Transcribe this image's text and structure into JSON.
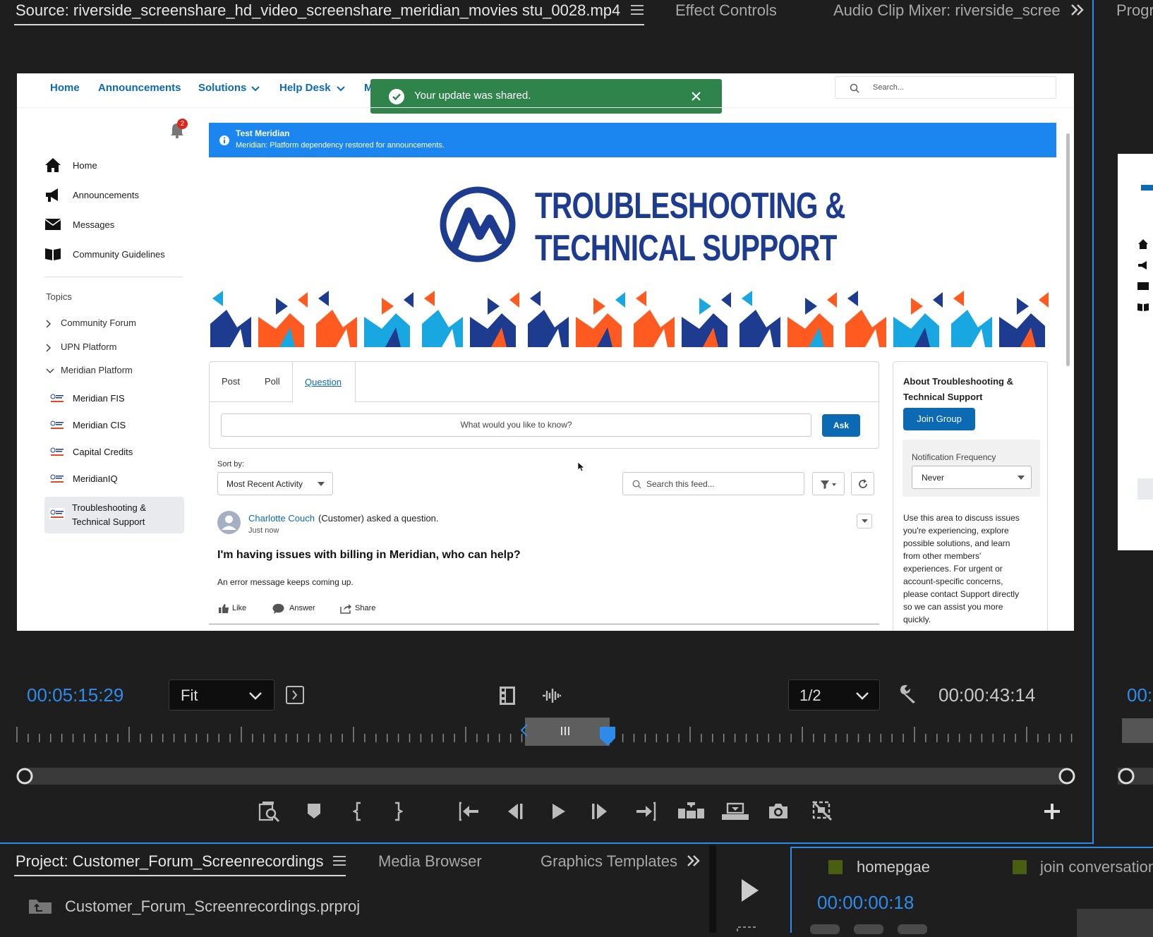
{
  "tabs": {
    "source": "Source: riverside_screenshare_hd_video_screenshare_meridian_movies stu_0028.mp4",
    "effect_controls": "Effect Controls",
    "audio_mixer": "Audio Clip Mixer: riverside_screei",
    "program": "Progr"
  },
  "site": {
    "nav": [
      "Home",
      "Announcements",
      "Solutions",
      "Help Desk",
      "M"
    ],
    "search_placeholder": "Search...",
    "toast": "Your update was shared.",
    "notification_count": "2",
    "sidebar": [
      "Home",
      "Announcements",
      "Messages",
      "Community Guidelines"
    ],
    "topics_heading": "Topics",
    "topics": [
      "Community Forum",
      "UPN Platform",
      "Meridian Platform"
    ],
    "subtopics": [
      "Meridian FIS",
      "Meridian CIS",
      "Capital Credits",
      "MeridianIQ"
    ],
    "selected_group_line1": "Troubleshooting &",
    "selected_group_line2": "Technical Support",
    "banner_title": "Test Meridian",
    "banner_text": "Meridian: Platform dependency restored for announcements.",
    "hero_line1": "TROUBLESHOOTING &",
    "hero_line2": "TECHNICAL SUPPORT",
    "publisher_tabs": [
      "Post",
      "Poll",
      "Question"
    ],
    "question_placeholder": "What would you like to know?",
    "ask_label": "Ask",
    "sort_label": "Sort by:",
    "sort_value": "Most Recent Activity",
    "feed_search_placeholder": "Search this feed...",
    "post_author": "Charlotte Couch",
    "post_action": "(Customer) asked a question.",
    "post_time": "Just now",
    "post_title": "I'm having issues with billing in Meridian, who can help?",
    "post_body": "An error message keeps coming up.",
    "post_actions": [
      "Like",
      "Answer",
      "Share"
    ],
    "about_title_1": "About Troubleshooting &",
    "about_title_2": "Technical Support",
    "join_label": "Join Group",
    "notif_label": "Notification Frequency",
    "notif_value": "Never",
    "about_desc": [
      "Use this area to discuss issues",
      "you're experiencing, explore",
      "possible solutions, and learn",
      "from other members'",
      "experiences. For urgent or",
      "account-specific concerns,",
      "please contact Support directly",
      "so we can assist you more",
      "quickly."
    ]
  },
  "source_monitor": {
    "timecode_left": "00:05:15:29",
    "zoom": "Fit",
    "resolution": "1/2",
    "timecode_right": "00:00:43:14",
    "program_timecode": "00:"
  },
  "project": {
    "tab_project": "Project: Customer_Forum_Screenrecordings",
    "tab_media": "Media Browser",
    "tab_graphics": "Graphics Templates",
    "file": "Customer_Forum_Screenrecordings.prproj"
  },
  "timeline": {
    "tab1": "homepgae",
    "tab2": "join conversation",
    "timecode": "00:00:00:18"
  },
  "colors": {
    "accent_blue": "#2d8ceb",
    "site_blue": "#0b6ab3",
    "toast_green": "#2e844a",
    "banner_blue": "#1b86f0"
  }
}
